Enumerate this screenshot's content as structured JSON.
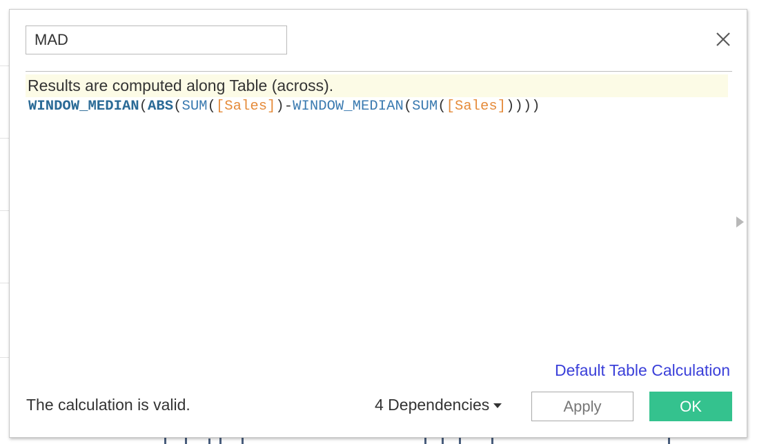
{
  "dialog": {
    "name_value": "MAD",
    "info_banner": "Results are computed along Table (across).",
    "formula": {
      "t1": "WINDOW_MEDIAN",
      "t2": "(",
      "t3": "ABS",
      "t4": "(",
      "t5": "SUM",
      "t6": "(",
      "t7": "[Sales]",
      "t8": ")",
      "t9": "-",
      "t10": "WINDOW_MEDIAN",
      "t11": "(",
      "t12": "SUM",
      "t13": "(",
      "t14": "[Sales]",
      "t15": "))))"
    },
    "default_table_calc_link": "Default Table Calculation",
    "status": "The calculation is valid.",
    "dependencies_label": "4 Dependencies",
    "apply_label": "Apply",
    "ok_label": "OK"
  },
  "icons": {
    "close": "close-icon",
    "expand": "triangle-right-icon",
    "dropdown": "caret-down-icon"
  },
  "colors": {
    "ok_button": "#34c28e",
    "link": "#3a3fd9",
    "info_banner_bg": "#fcfbe6",
    "function_token": "#2a6a96",
    "field_token": "#e58b3a"
  }
}
